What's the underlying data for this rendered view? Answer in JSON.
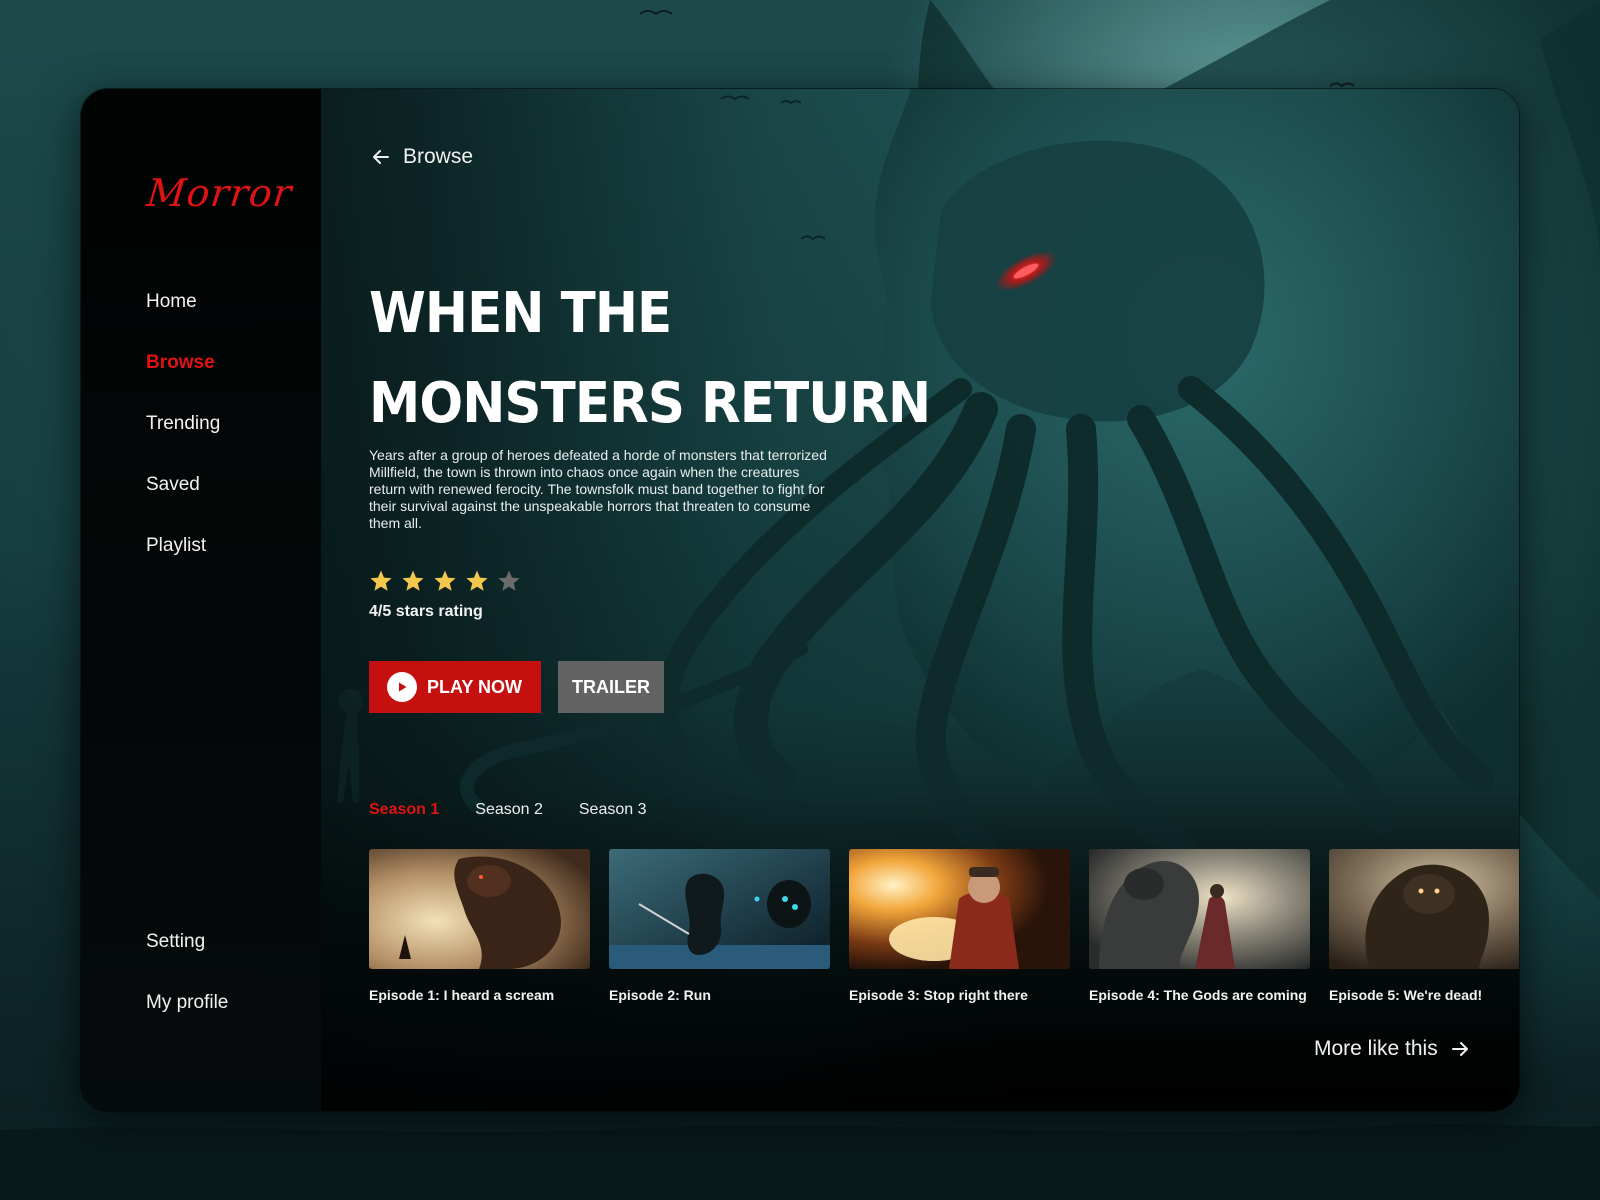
{
  "app": {
    "logo": "Morror"
  },
  "sidebar": {
    "items": [
      {
        "label": "Home",
        "active": false
      },
      {
        "label": "Browse",
        "active": true
      },
      {
        "label": "Trending",
        "active": false
      },
      {
        "label": "Saved",
        "active": false
      },
      {
        "label": "Playlist",
        "active": false
      }
    ],
    "bottom_items": [
      {
        "label": "Setting"
      },
      {
        "label": "My profile"
      }
    ]
  },
  "header": {
    "back_label": "Browse"
  },
  "hero": {
    "title_line1": "WHEN THE",
    "title_line2": "MONSTERS RETURN",
    "description": "Years after a group of heroes defeated a horde of monsters that terrorized Millfield, the town is thrown into chaos once again when the creatures return with renewed ferocity. The townsfolk must band together to fight for their survival against the unspeakable horrors that threaten to consume them all.",
    "rating": {
      "value": 4,
      "max": 5,
      "label": "4/5 stars rating"
    },
    "play_label": "PLAY NOW",
    "trailer_label": "TRAILER"
  },
  "seasons": {
    "tabs": [
      {
        "label": "Season 1",
        "active": true
      },
      {
        "label": "Season 2",
        "active": false
      },
      {
        "label": "Season 3",
        "active": false
      }
    ]
  },
  "episodes": [
    {
      "title": "Episode 1: I heard a scream"
    },
    {
      "title": "Episode 2: Run"
    },
    {
      "title": "Episode 3: Stop right there"
    },
    {
      "title": "Episode 4: The Gods are coming"
    },
    {
      "title": "Episode 5: We're dead!"
    }
  ],
  "footer": {
    "more_label": "More like this"
  },
  "colors": {
    "accent": "#e01313",
    "play_button": "#c4100f",
    "trailer_button": "#646363",
    "star_filled": "#f3c74b",
    "star_empty": "#6b6b6b"
  },
  "icons": {
    "back": "arrow-left-icon",
    "play": "play-icon",
    "star": "star-icon",
    "more": "arrow-right-icon"
  }
}
